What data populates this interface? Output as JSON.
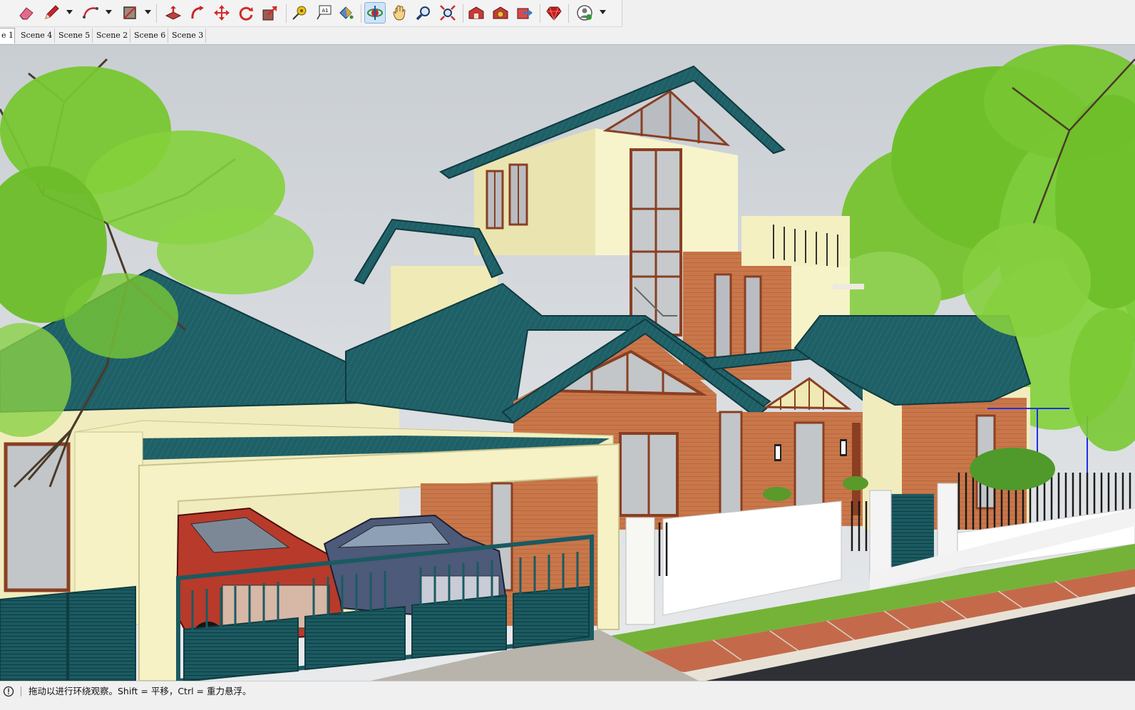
{
  "toolbar": {
    "tools": [
      {
        "name": "eraser-tool",
        "icon": "eraser-icon"
      },
      {
        "name": "line-tool",
        "icon": "pencil-icon"
      },
      {
        "name": "arc-tool",
        "icon": "arc-icon"
      },
      {
        "name": "rectangle-tool",
        "icon": "rectangle-icon"
      },
      {
        "name": "push-pull-tool",
        "icon": "push-pull-icon"
      },
      {
        "name": "follow-me-tool",
        "icon": "follow-me-icon"
      },
      {
        "name": "move-tool",
        "icon": "move-arrows-icon"
      },
      {
        "name": "rotate-tool",
        "icon": "rotate-icon"
      },
      {
        "name": "scale-tool",
        "icon": "scale-icon"
      },
      {
        "name": "tape-measure-tool",
        "icon": "tape-measure-icon"
      },
      {
        "name": "text-tool",
        "icon": "text-label-icon"
      },
      {
        "name": "paint-bucket-tool",
        "icon": "paint-bucket-icon"
      },
      {
        "name": "orbit-tool",
        "icon": "orbit-icon",
        "active": true
      },
      {
        "name": "pan-tool",
        "icon": "hand-icon"
      },
      {
        "name": "zoom-tool",
        "icon": "magnifier-icon"
      },
      {
        "name": "zoom-extents-tool",
        "icon": "zoom-extents-icon"
      },
      {
        "name": "3d-warehouse-tool",
        "icon": "warehouse-icon"
      },
      {
        "name": "extension-warehouse-tool",
        "icon": "extension-icon"
      },
      {
        "name": "share-model-tool",
        "icon": "share-model-icon"
      },
      {
        "name": "ruby-console-tool",
        "icon": "ruby-gem-icon"
      },
      {
        "name": "account-tool",
        "icon": "user-account-icon"
      }
    ],
    "colors": {
      "accent": "#2f7fd0",
      "red": "#d8262b",
      "active_bg": "#cfe4f7"
    }
  },
  "scene_tabs": [
    {
      "label": "e 1",
      "selected": true
    },
    {
      "label": "Scene 4"
    },
    {
      "label": "Scene 5"
    },
    {
      "label": "Scene 2"
    },
    {
      "label": "Scene 6"
    },
    {
      "label": "Scene 3"
    }
  ],
  "viewport": {
    "content": "3d-house-model",
    "colors": {
      "roof": "#1f5f66",
      "roof_light": "#2a747c",
      "wall_cream": "#f3efbe",
      "brick": "#c9774a",
      "glass": "#b9bdc2",
      "trim": "#8a3f22",
      "fence": "#16555c",
      "grass": "#74b338",
      "road": "#2e3035",
      "sky": "#dde1e4",
      "foliage": "#6fbf2a"
    }
  },
  "status": {
    "icon": "info-circle-icon",
    "text": "拖动以进行环绕观察。Shift = 平移，Ctrl = 重力悬浮。"
  }
}
